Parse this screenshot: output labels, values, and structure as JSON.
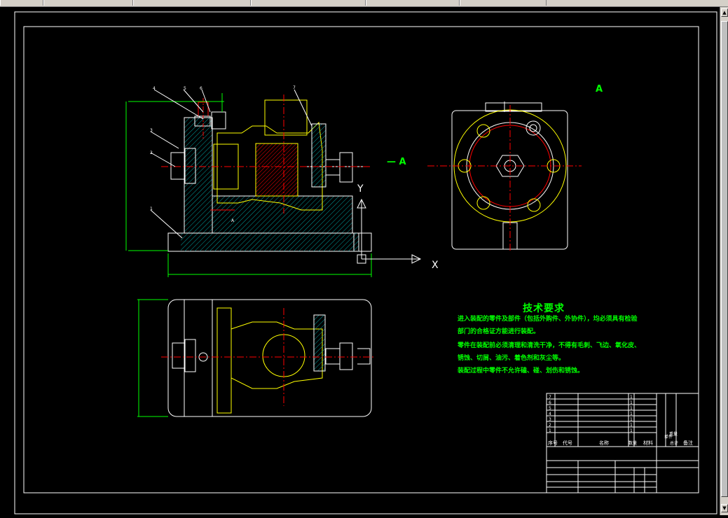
{
  "toolbar": {
    "segments": [
      "",
      "",
      "",
      "",
      "",
      ""
    ]
  },
  "scrollbar": {
    "up_arrow": "▲",
    "down_arrow": "▼"
  },
  "drawing": {
    "view_label": "A",
    "section_label": "A",
    "axis_x": "X",
    "axis_y": "Y",
    "part_numbers": [
      "1",
      "2",
      "3",
      "4",
      "5",
      "6",
      "7"
    ],
    "tech_requirements": {
      "title": "技术要求",
      "lines": [
        "进入装配的零件及部件（包括外购件、外协件），均必须具有检验",
        "部门的合格证方能进行装配。",
        "零件在装配前必须清理和清洗干净，不得有毛刺、飞边、氧化皮、",
        "锈蚀、切屑、油污、着色剂和灰尘等。",
        "装配过程中零件不允许磕、碰、划伤和锈蚀。"
      ]
    },
    "title_block": {
      "header": [
        "序号",
        "代号",
        "名称",
        "数量",
        "材料",
        "单件",
        "总计",
        "备注"
      ],
      "weight_label": "重量",
      "rows": [
        [
          "7",
          "",
          "",
          "1",
          "",
          ""
        ],
        [
          "6",
          "",
          "",
          "1",
          "",
          ""
        ],
        [
          "5",
          "",
          "",
          "1",
          "",
          ""
        ],
        [
          "4",
          "",
          "",
          "1",
          "",
          ""
        ],
        [
          "3",
          "",
          "",
          "1",
          "",
          ""
        ],
        [
          "2",
          "",
          "",
          "1",
          "",
          ""
        ],
        [
          "1",
          "",
          "",
          "1",
          "",
          ""
        ]
      ]
    }
  },
  "colors": {
    "background": "#000000",
    "outline": "#ffffff",
    "part": "#ffff00",
    "dimension": "#00ff00",
    "centerline": "#ff0000",
    "hatch": "#00c0c0",
    "text": "#00ff00"
  }
}
